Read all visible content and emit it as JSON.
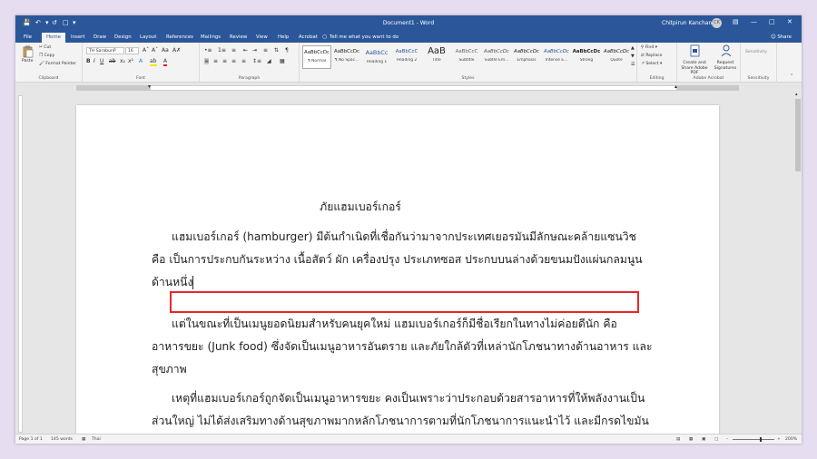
{
  "titlebar": {
    "title": "Document1 - Word",
    "user": "Chitpirun Kanchana",
    "avatar": "CK"
  },
  "tabs": [
    "File",
    "Home",
    "Insert",
    "Draw",
    "Design",
    "Layout",
    "References",
    "Mailings",
    "Review",
    "View",
    "Help",
    "Acrobat"
  ],
  "active_tab": "Home",
  "tellme": "Tell me what you want to do",
  "share": "Share",
  "ribbon": {
    "clipboard": {
      "paste": "Paste",
      "cut": "Cut",
      "copy": "Copy",
      "format_painter": "Format Painter",
      "label": "Clipboard"
    },
    "font": {
      "name": "TH SarabunP",
      "size": "16",
      "label": "Font"
    },
    "paragraph": {
      "label": "Paragraph"
    },
    "styles": {
      "items": [
        {
          "sample": "AaBbCcDc",
          "name": "¶ Normal"
        },
        {
          "sample": "AaBbCcDc",
          "name": "¶ No Spac..."
        },
        {
          "sample": "AaBbCc",
          "name": "Heading 1"
        },
        {
          "sample": "AaBbCcC",
          "name": "Heading 2"
        },
        {
          "sample": "AaB",
          "name": "Title"
        },
        {
          "sample": "AaBbCcC",
          "name": "Subtitle"
        },
        {
          "sample": "AaBbCcDc",
          "name": "Subtle Em..."
        },
        {
          "sample": "AaBbCcDc",
          "name": "Emphasis"
        },
        {
          "sample": "AaBbCcDc",
          "name": "Intense E..."
        },
        {
          "sample": "AaBbCcDc",
          "name": "Strong"
        },
        {
          "sample": "AaBbCcDc",
          "name": "Quote"
        }
      ],
      "label": "Styles"
    },
    "editing": {
      "find": "Find",
      "replace": "Replace",
      "select": "Select",
      "label": "Editing"
    },
    "acrobat": {
      "create_share": "Create and Share Adobe PDF",
      "request_signatures": "Request Signatures",
      "label": "Adobe Acrobat"
    },
    "sensitivity": {
      "button": "Sensitivity",
      "label": "Sensitivity"
    }
  },
  "document": {
    "title": "ภัยแฮมเบอร์เกอร์",
    "lines": [
      "แฮมเบอร์เกอร์ (hamburger) มีต้นกำเนิดที่เชื่อกันว่ามาจากประเทศเยอรมันมีลักษณะคล้ายแซนวิช",
      "คือ เป็นการประกบกันระหว่าง เนื้อสัตว์ ผัก เครื่องปรุง ประเภทซอส ประกบบนล่างด้วยขนมปังแผ่นกลมนูน",
      "ด้านหนึ่ง",
      "แต่ในขณะที่เป็นเมนูยอดนิยมสำหรับคนยุคใหม่ แฮมเบอร์เกอร์ก็มีชื่อเรียกในทางไม่ค่อยดีนัก คือ",
      "อาหารขยะ (Junk food) ซึ่งจัดเป็นเมนูอาหารอันตราย และภัยใกล้ตัวที่เหล่านักโภชนาทางด้านอาหาร และ",
      "สุขภาพ",
      "เหตุที่แฮมเบอร์เกอร์ถูกจัดเป็นเมนูอาหารขยะ คงเป็นเพราะว่าประกอบด้วยสารอาหารที่ให้พลังงานเป็น",
      "ส่วนใหญ่ ไม่ได้ส่งเสริมทางด้านสุขภาพมากหลักโภชนาการตามที่นักโภชนาการแนะนำไว้ และมีกรดไขมัน"
    ]
  },
  "status": {
    "page": "Page 1 of 1",
    "words": "145 words",
    "language": "Thai",
    "zoom": "200%"
  }
}
